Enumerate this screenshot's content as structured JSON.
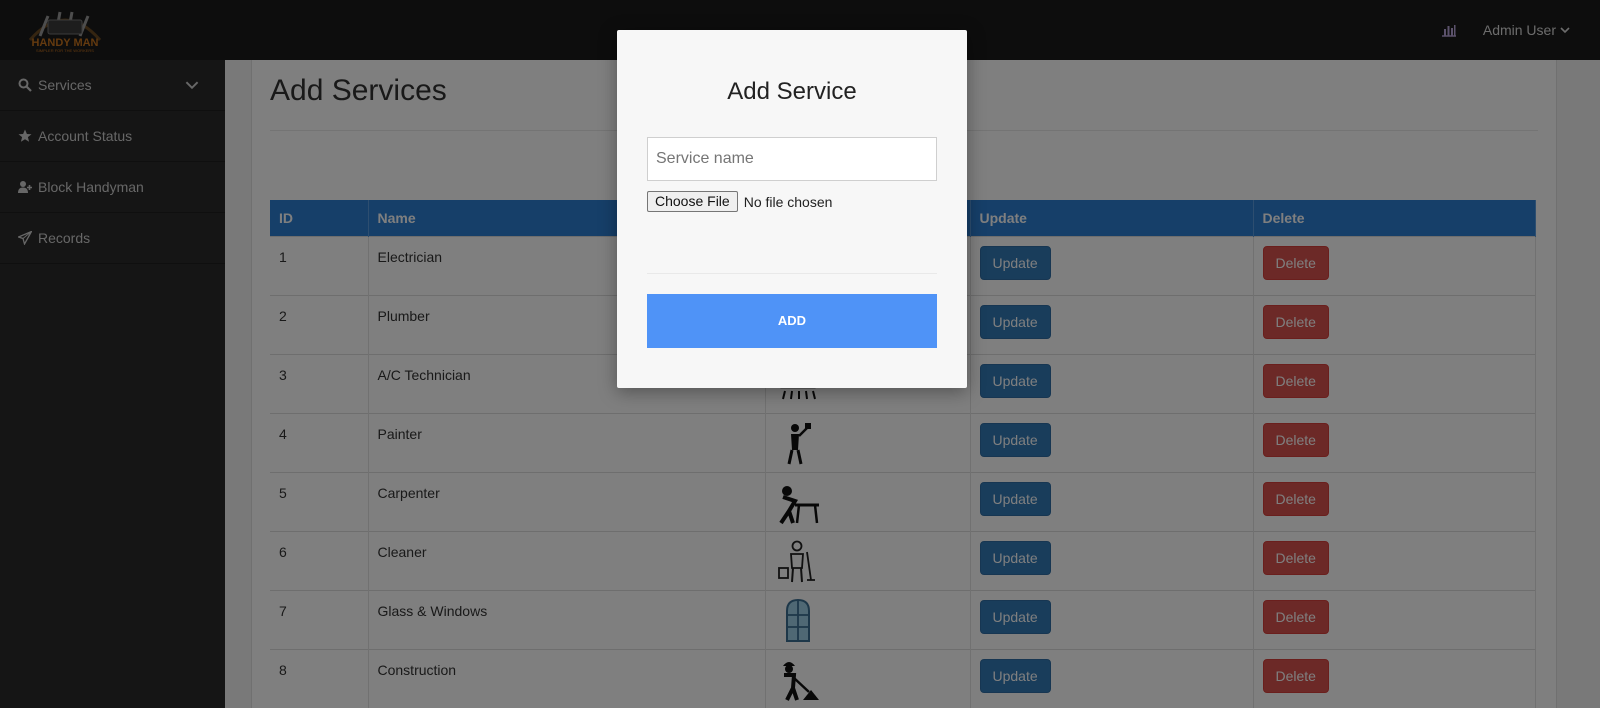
{
  "brand": {
    "logo_text": "HANDY MAN",
    "logo_tagline": "SIMPLER FOR THE WORKERS"
  },
  "header": {
    "user_label": "Admin User"
  },
  "sidebar": {
    "items": [
      {
        "label": "Services",
        "icon": "search-icon"
      },
      {
        "label": "Account Status",
        "icon": "star-icon"
      },
      {
        "label": "Block Handyman",
        "icon": "user-plus-icon"
      },
      {
        "label": "Records",
        "icon": "paper-plane-icon"
      }
    ]
  },
  "main": {
    "title": "Add Services",
    "table": {
      "headers": {
        "id": "ID",
        "name": "Name",
        "update": "Update",
        "delete": "Delete"
      },
      "rows": [
        {
          "id": "1",
          "name": "Electrician",
          "image": "electrician-icon"
        },
        {
          "id": "2",
          "name": "Plumber",
          "image": "plumber-icon"
        },
        {
          "id": "3",
          "name": "A/C Technician",
          "image": "ac-unit-icon"
        },
        {
          "id": "4",
          "name": "Painter",
          "image": "painter-icon"
        },
        {
          "id": "5",
          "name": "Carpenter",
          "image": "carpenter-icon"
        },
        {
          "id": "6",
          "name": "Cleaner",
          "image": "cleaner-icon"
        },
        {
          "id": "7",
          "name": "Glass & Windows",
          "image": "window-icon"
        },
        {
          "id": "8",
          "name": "Construction",
          "image": "construction-worker-icon"
        }
      ],
      "update_label": "Update",
      "delete_label": "Delete"
    }
  },
  "modal": {
    "title": "Add Service",
    "input_placeholder": "Service name",
    "input_value": "",
    "file_button": "Choose File",
    "file_status": "No file chosen",
    "submit_label": "ADD"
  },
  "colors": {
    "topbar": "#1a1a1a",
    "sidebar": "#2a2a2a",
    "table_header": "#2d7fd3",
    "update_button": "#337ab7",
    "delete_button": "#d9534f",
    "modal_submit": "#4f93f7"
  }
}
